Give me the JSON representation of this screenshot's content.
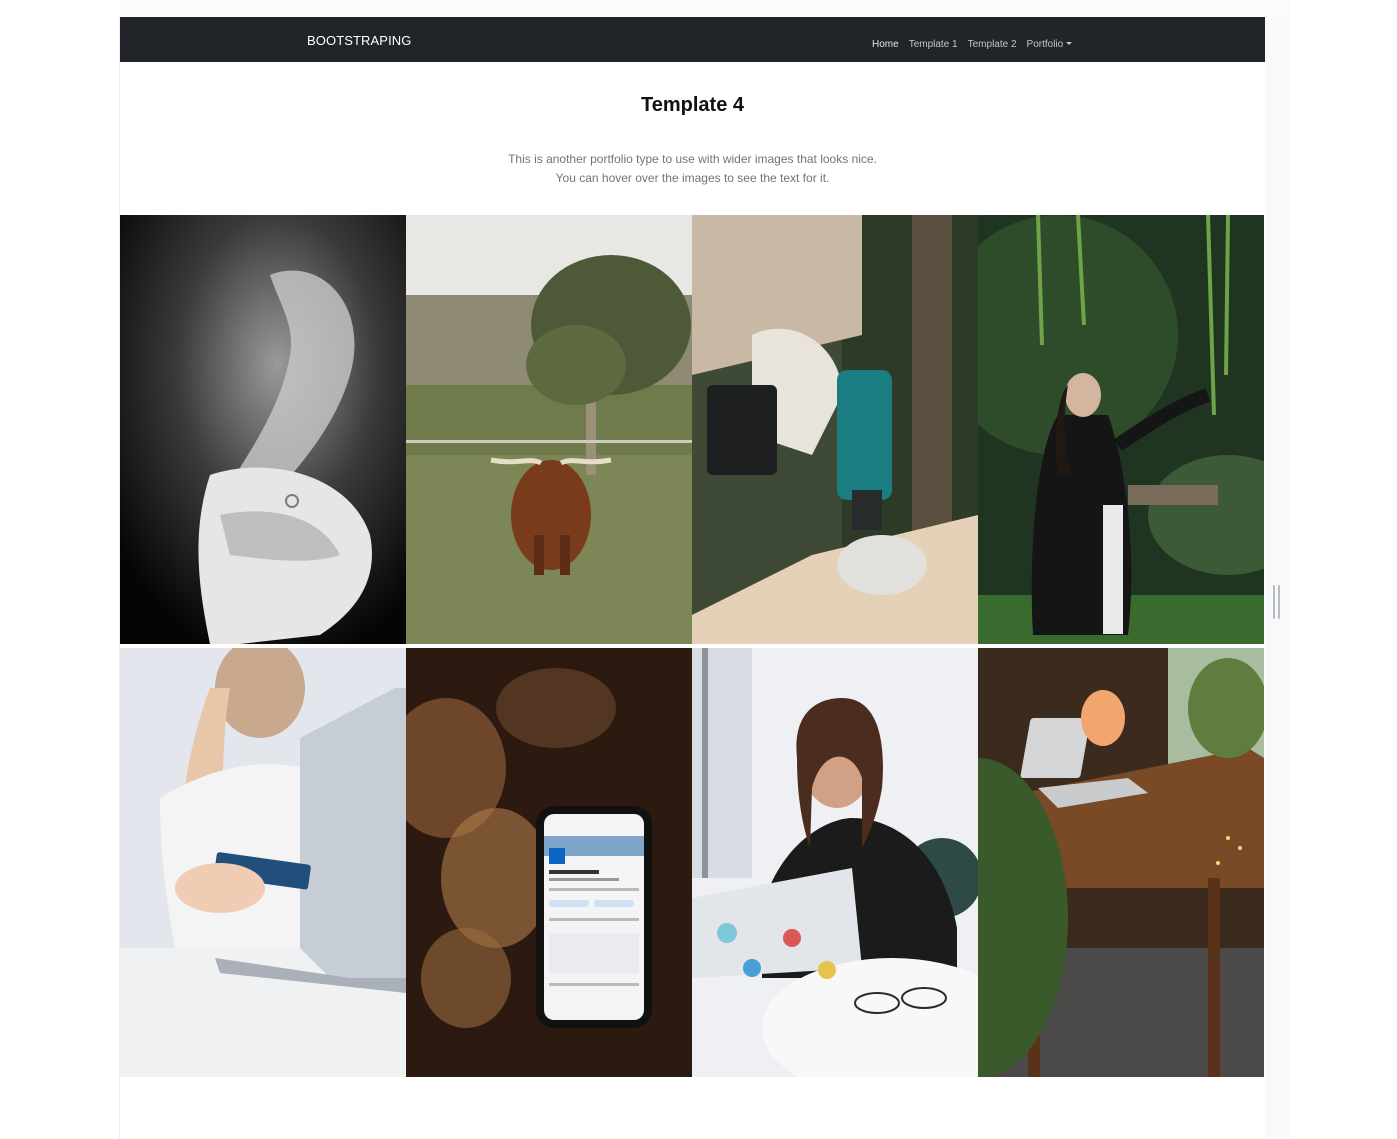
{
  "navbar": {
    "brand": "BOOTSTRAPING",
    "links": [
      {
        "label": "Home"
      },
      {
        "label": "Template 1"
      },
      {
        "label": "Template 2"
      },
      {
        "label": "Portfolio"
      }
    ]
  },
  "main": {
    "title": "Template 4",
    "description_line1": "This is another portfolio type to use with wider images that looks nice.",
    "description_line2": "You can hover over the images to see the text for it."
  },
  "gallery": {
    "images": [
      {
        "subject": "hands-photo"
      },
      {
        "subject": "highland-cow-photo"
      },
      {
        "subject": "power-drill-photo"
      },
      {
        "subject": "woman-in-park-photo"
      },
      {
        "subject": "credit-card-laptop-photo"
      },
      {
        "subject": "linkedin-phone-photo"
      },
      {
        "subject": "woman-at-laptop-photo"
      },
      {
        "subject": "desk-with-laptop-photo"
      }
    ]
  },
  "colors": {
    "navbar_bg": "#212529",
    "brand_text": "#ffffff",
    "nav_link": "#c2c6ca",
    "description_text": "#6c757d"
  }
}
